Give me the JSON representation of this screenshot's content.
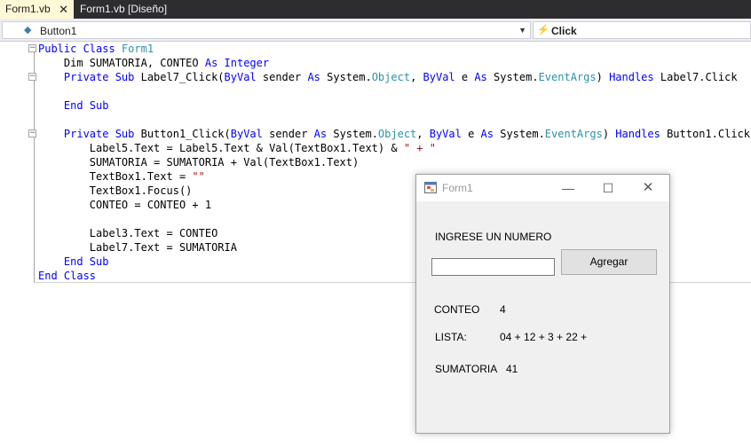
{
  "tabs": [
    {
      "label": "Form1.vb",
      "close": "✕"
    },
    {
      "label": "Form1.vb [Diseño]"
    }
  ],
  "navbar": {
    "object_dropdown": "Button1",
    "event_dropdown": "Click"
  },
  "code": {
    "line1": [
      "Public Class",
      " ",
      "Form1"
    ],
    "line2": [
      "    Dim SUMATORIA, CONTEO ",
      "As",
      " ",
      "Integer"
    ],
    "line3": [
      "    Private Sub",
      " Label7_Click(",
      "ByVal",
      " sender ",
      "As",
      " System.",
      "Object",
      ", ",
      "ByVal",
      " e ",
      "As",
      " System.",
      "EventArgs",
      ") ",
      "Handles",
      " Label7.Click"
    ],
    "line5": [
      "    End Sub"
    ],
    "line7": [
      "    Private Sub",
      " Button1_Click(",
      "ByVal",
      " sender ",
      "As",
      " System.",
      "Object",
      ", ",
      "ByVal",
      " e ",
      "As",
      " System.",
      "EventArgs",
      ") ",
      "Handles",
      " Button1.Click"
    ],
    "line8": [
      "        Label5.Text = Label5.Text & Val(TextBox1.Text) & ",
      "\" + \""
    ],
    "line9": [
      "        SUMATORIA = SUMATORIA + Val(TextBox1.Text)"
    ],
    "line10": [
      "        TextBox1.Text = ",
      "\"\""
    ],
    "line11": [
      "        TextBox1.Focus()"
    ],
    "line12": [
      "        CONTEO = CONTEO + 1"
    ],
    "line14": [
      "        Label3.Text = CONTEO"
    ],
    "line15": [
      "        Label7.Text = SUMATORIA"
    ],
    "line16": [
      "    End Sub"
    ],
    "line17": [
      "End Class"
    ]
  },
  "form": {
    "title": "Form1",
    "prompt_label": "INGRESE UN NUMERO",
    "textbox_value": "",
    "button_label": "Agregar",
    "conteo_label": "CONTEO",
    "conteo_value": "4",
    "lista_label": "LISTA:",
    "lista_value": "04 + 12 + 3 + 22 +",
    "sumatoria_label": "SUMATORIA",
    "sumatoria_value": "41"
  }
}
